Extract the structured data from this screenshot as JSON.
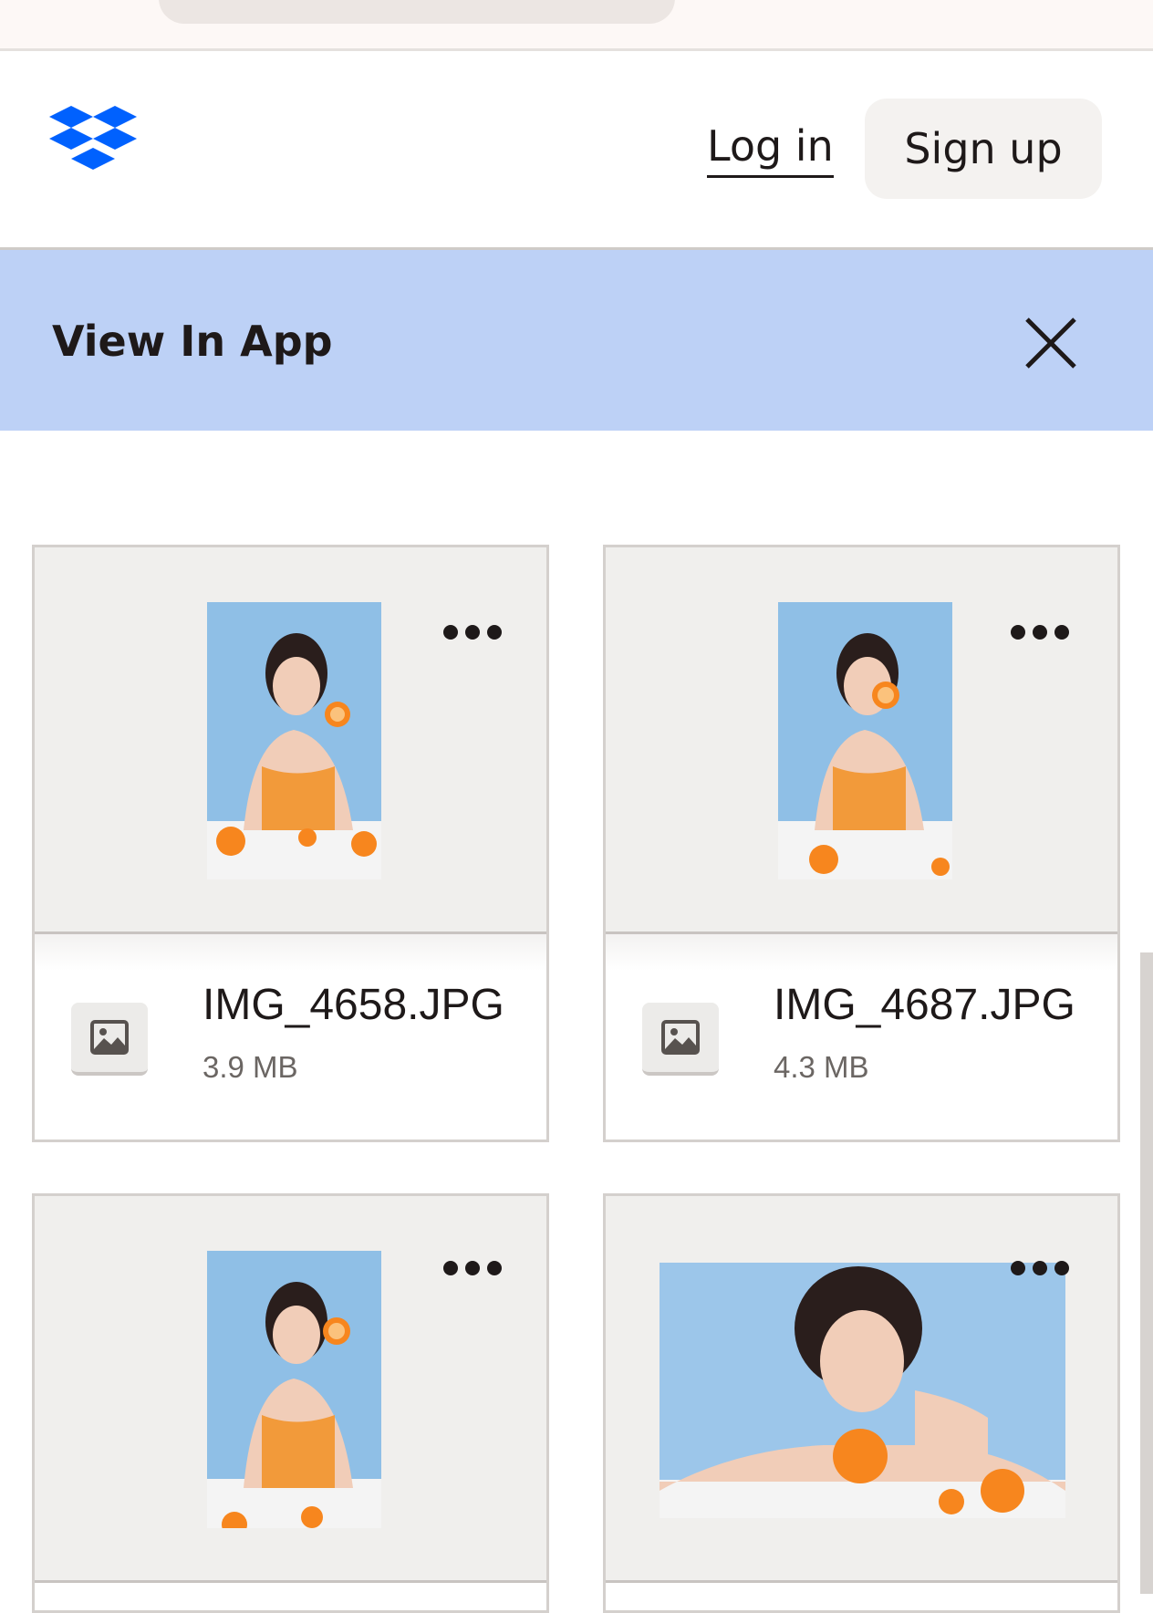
{
  "header": {
    "login_label": "Log in",
    "signup_label": "Sign up",
    "logo_icon": "dropbox-logo-icon",
    "brand_color": "#0061fe"
  },
  "banner": {
    "title": "View In App",
    "close_icon": "close-icon",
    "background": "#bdd1f6"
  },
  "files": [
    {
      "name": "IMG_4658.JPG",
      "size": "3.9 MB",
      "type_icon": "image-file-icon"
    },
    {
      "name": "IMG_4687.JPG",
      "size": "4.3 MB",
      "type_icon": "image-file-icon"
    },
    {
      "name": "",
      "size": "",
      "type_icon": "image-file-icon"
    },
    {
      "name": "",
      "size": "",
      "type_icon": "image-file-icon"
    }
  ]
}
